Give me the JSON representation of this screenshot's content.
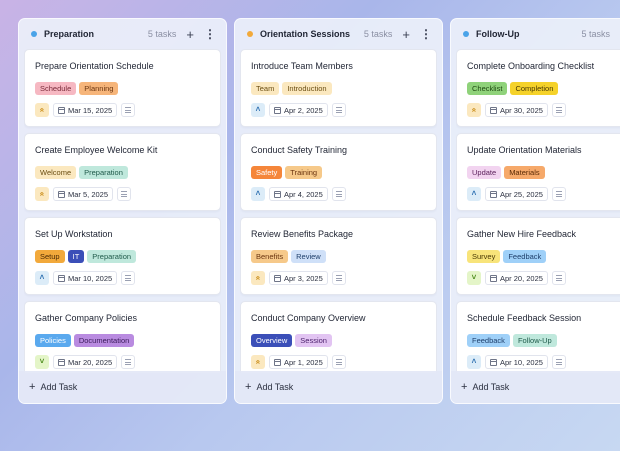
{
  "columns": [
    {
      "title": "Preparation",
      "count": "5 tasks",
      "dot_color": "#4aa3e8",
      "add_label": "Add Task",
      "cards": [
        {
          "title": "Prepare Orientation Schedule",
          "tags": [
            {
              "label": "Schedule",
              "bg": "#f6b8c2",
              "fg": "#7a2b3a"
            },
            {
              "label": "Planning",
              "bg": "#f6b57a",
              "fg": "#6b3510"
            }
          ],
          "priority": "high",
          "date": "Mar 15, 2025"
        },
        {
          "title": "Create Employee Welcome Kit",
          "tags": [
            {
              "label": "Welcome",
              "bg": "#fbe8bf",
              "fg": "#6b4e12"
            },
            {
              "label": "Preparation",
              "bg": "#bfe8dc",
              "fg": "#1f5a4a"
            }
          ],
          "priority": "high",
          "date": "Mar 5, 2025"
        },
        {
          "title": "Set Up Workstation",
          "tags": [
            {
              "label": "Setup",
              "bg": "#f2a93b",
              "fg": "#4a2a05"
            },
            {
              "label": "IT",
              "bg": "#3b4fb8",
              "fg": "#ffffff"
            },
            {
              "label": "Preparation",
              "bg": "#bfe8dc",
              "fg": "#1f5a4a"
            }
          ],
          "priority": "medium",
          "date": "Mar 10, 2025"
        },
        {
          "title": "Gather Company Policies",
          "tags": [
            {
              "label": "Policies",
              "bg": "#5aa9ee",
              "fg": "#ffffff"
            },
            {
              "label": "Documentation",
              "bg": "#b98be0",
              "fg": "#3a1b5a"
            }
          ],
          "priority": "low",
          "date": "Mar 20, 2025"
        }
      ]
    },
    {
      "title": "Orientation Sessions",
      "count": "5 tasks",
      "dot_color": "#f2a93b",
      "add_label": "Add Task",
      "cards": [
        {
          "title": "Introduce Team Members",
          "tags": [
            {
              "label": "Team",
              "bg": "#fbe8bf",
              "fg": "#6b4e12"
            },
            {
              "label": "Introduction",
              "bg": "#fbe8bf",
              "fg": "#6b4e12"
            }
          ],
          "priority": "medium",
          "date": "Apr 2, 2025"
        },
        {
          "title": "Conduct Safety Training",
          "tags": [
            {
              "label": "Safety",
              "bg": "#f5863a",
              "fg": "#ffffff"
            },
            {
              "label": "Training",
              "bg": "#f6c98a",
              "fg": "#6b3510"
            }
          ],
          "priority": "medium",
          "date": "Apr 4, 2025"
        },
        {
          "title": "Review Benefits Package",
          "tags": [
            {
              "label": "Benefits",
              "bg": "#f6c98a",
              "fg": "#6b3510"
            },
            {
              "label": "Review",
              "bg": "#cfe0f8",
              "fg": "#1f3f6b"
            }
          ],
          "priority": "high",
          "date": "Apr 3, 2025"
        },
        {
          "title": "Conduct Company Overview",
          "tags": [
            {
              "label": "Overview",
              "bg": "#3b4fb8",
              "fg": "#ffffff"
            },
            {
              "label": "Session",
              "bg": "#e2c4f2",
              "fg": "#4a1f6b"
            }
          ],
          "priority": "high",
          "date": "Apr 1, 2025"
        }
      ]
    },
    {
      "title": "Follow-Up",
      "count": "5 tasks",
      "dot_color": "#4aa3e8",
      "add_label": "Add Task",
      "cards": [
        {
          "title": "Complete Onboarding Checklist",
          "tags": [
            {
              "label": "Checklist",
              "bg": "#8fd27a",
              "fg": "#1f4a12"
            },
            {
              "label": "Completion",
              "bg": "#f5d22a",
              "fg": "#4a3a05"
            }
          ],
          "priority": "high",
          "date": "Apr 30, 2025"
        },
        {
          "title": "Update Orientation Materials",
          "tags": [
            {
              "label": "Update",
              "bg": "#f2d4f0",
              "fg": "#5a1f5a"
            },
            {
              "label": "Materials",
              "bg": "#f6a96a",
              "fg": "#5a2a05"
            }
          ],
          "priority": "medium",
          "date": "Apr 25, 2025"
        },
        {
          "title": "Gather New Hire Feedback",
          "tags": [
            {
              "label": "Survey",
              "bg": "#f8e47a",
              "fg": "#4a3a05"
            },
            {
              "label": "Feedback",
              "bg": "#9fd0f8",
              "fg": "#1f3f6b"
            }
          ],
          "priority": "low",
          "date": "Apr 20, 2025"
        },
        {
          "title": "Schedule Feedback Session",
          "tags": [
            {
              "label": "Feedback",
              "bg": "#9fd0f8",
              "fg": "#1f3f6b"
            },
            {
              "label": "Follow-Up",
              "bg": "#bfe8dc",
              "fg": "#1f5a4a"
            }
          ],
          "priority": "medium",
          "date": "Apr 10, 2025"
        }
      ]
    }
  ],
  "priority_styles": {
    "high": {
      "glyph": "»",
      "bg": "#fbe8bf",
      "fg": "#c98a14",
      "icon": "double-chevron-up-icon"
    },
    "medium": {
      "glyph": "˄",
      "bg": "#dcecf8",
      "fg": "#2d6fb0",
      "icon": "chevron-up-icon"
    },
    "low": {
      "glyph": "˅",
      "bg": "#e4f5c8",
      "fg": "#4a8a1a",
      "icon": "chevron-down-icon"
    }
  }
}
